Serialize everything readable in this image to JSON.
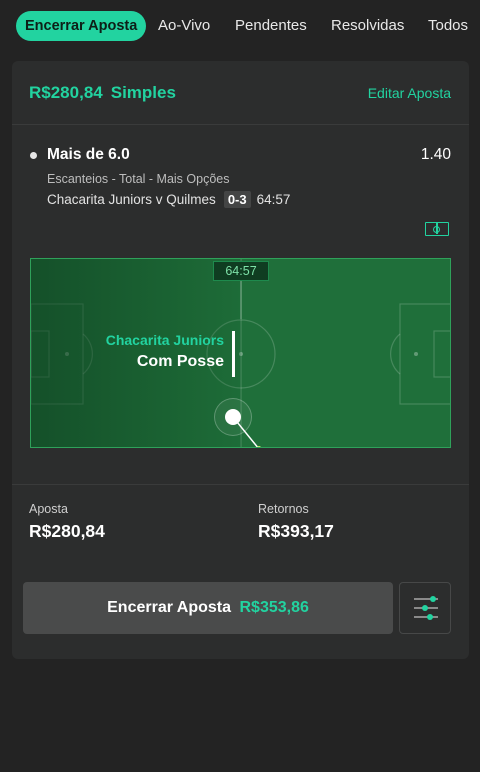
{
  "tabs": [
    {
      "label": "Encerrar Aposta",
      "active": true
    },
    {
      "label": "Ao-Vivo",
      "active": false
    },
    {
      "label": "Pendentes",
      "active": false
    },
    {
      "label": "Resolvidas",
      "active": false
    },
    {
      "label": "Todos",
      "active": false
    }
  ],
  "bet": {
    "stake_amount": "R$280,84",
    "type": "Simples",
    "edit_label": "Editar Aposta",
    "selection": "Mais de 6.0",
    "odds": "1.40",
    "market": "Escanteios - Total - Mais Opções",
    "match": "Chacarita Juniors v Quilmes",
    "score": "0-3",
    "time": "64:57"
  },
  "pitch": {
    "clock": "64:57",
    "team": "Chacarita Juniors",
    "status": "Com Posse",
    "icon": "pitch-view-icon"
  },
  "summary": {
    "stake_label": "Aposta",
    "stake_value": "R$280,84",
    "returns_label": "Retornos",
    "returns_value": "R$393,17"
  },
  "cashout": {
    "label": "Encerrar Aposta",
    "amount": "R$353,86",
    "settings_icon": "sliders-icon"
  },
  "colors": {
    "accent": "#22d3a0",
    "background": "#232323",
    "card": "#2c2d2d",
    "pitch": "#1f6f3a"
  }
}
